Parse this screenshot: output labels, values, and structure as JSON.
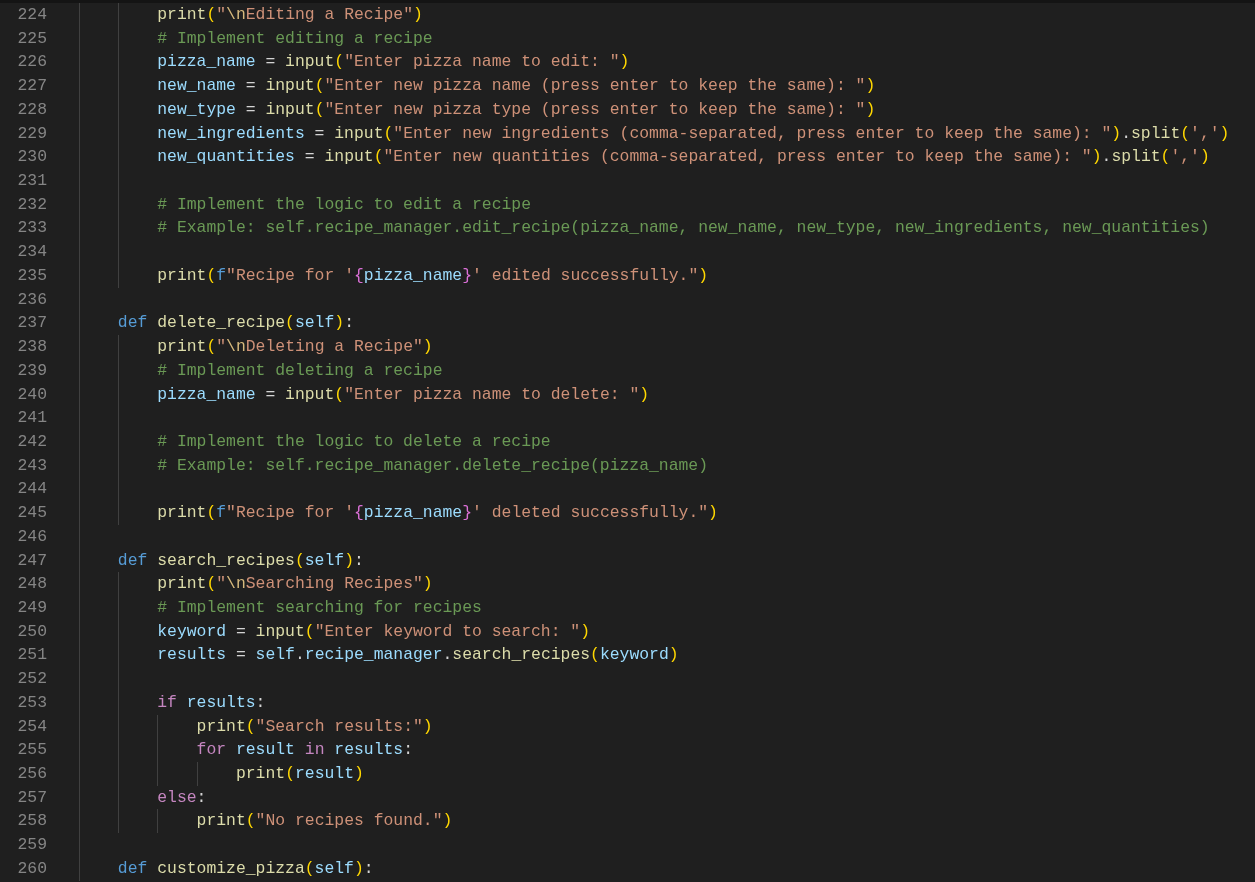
{
  "editor": {
    "lines": [
      {
        "children": [
          {
            "number": "224",
            "tokens": [
              {
                "kind": "fn",
                "text": "print"
              },
              {
                "kind": "b1",
                "text": "("
              },
              {
                "kind": "str",
                "text": "\""
              },
              {
                "kind": "esc",
                "text": "\\n"
              },
              {
                "kind": "str",
                "text": "Editing a Recipe\""
              },
              {
                "kind": "b1",
                "text": ")"
              }
            ]
          },
          {
            "number": "225",
            "tokens": [
              {
                "kind": "cmt",
                "text": "# Implement editing a recipe"
              }
            ]
          },
          {
            "number": "226",
            "tokens": [
              {
                "kind": "var",
                "text": "pizza_name"
              },
              {
                "kind": "plain",
                "text": " = "
              },
              {
                "kind": "fn",
                "text": "input"
              },
              {
                "kind": "b1",
                "text": "("
              },
              {
                "kind": "str",
                "text": "\"Enter pizza name to edit: \""
              },
              {
                "kind": "b1",
                "text": ")"
              }
            ]
          },
          {
            "number": "227",
            "tokens": [
              {
                "kind": "var",
                "text": "new_name"
              },
              {
                "kind": "plain",
                "text": " = "
              },
              {
                "kind": "fn",
                "text": "input"
              },
              {
                "kind": "b1",
                "text": "("
              },
              {
                "kind": "str",
                "text": "\"Enter new pizza name (press enter to keep the same): \""
              },
              {
                "kind": "b1",
                "text": ")"
              }
            ]
          },
          {
            "number": "228",
            "tokens": [
              {
                "kind": "var",
                "text": "new_type"
              },
              {
                "kind": "plain",
                "text": " = "
              },
              {
                "kind": "fn",
                "text": "input"
              },
              {
                "kind": "b1",
                "text": "("
              },
              {
                "kind": "str",
                "text": "\"Enter new pizza type (press enter to keep the same): \""
              },
              {
                "kind": "b1",
                "text": ")"
              }
            ]
          },
          {
            "number": "229",
            "tokens": [
              {
                "kind": "var",
                "text": "new_ingredients"
              },
              {
                "kind": "plain",
                "text": " = "
              },
              {
                "kind": "fn",
                "text": "input"
              },
              {
                "kind": "b1",
                "text": "("
              },
              {
                "kind": "str",
                "text": "\"Enter new ingredients (comma-separated, press enter to keep the same): \""
              },
              {
                "kind": "b1",
                "text": ")"
              },
              {
                "kind": "plain",
                "text": "."
              },
              {
                "kind": "fn",
                "text": "split"
              },
              {
                "kind": "b1",
                "text": "("
              },
              {
                "kind": "str",
                "text": "','"
              },
              {
                "kind": "b1",
                "text": ")"
              }
            ]
          },
          {
            "number": "230",
            "tokens": [
              {
                "kind": "var",
                "text": "new_quantities"
              },
              {
                "kind": "plain",
                "text": " = "
              },
              {
                "kind": "fn",
                "text": "input"
              },
              {
                "kind": "b1",
                "text": "("
              },
              {
                "kind": "str",
                "text": "\"Enter new quantities (comma-separated, press enter to keep the same): \""
              },
              {
                "kind": "b1",
                "text": ")"
              },
              {
                "kind": "plain",
                "text": "."
              },
              {
                "kind": "fn",
                "text": "split"
              },
              {
                "kind": "b1",
                "text": "("
              },
              {
                "kind": "str",
                "text": "','"
              },
              {
                "kind": "b1",
                "text": ")"
              }
            ]
          },
          {
            "number": "231"
          },
          {
            "number": "232",
            "tokens": [
              {
                "kind": "cmt",
                "text": "# Implement the logic to edit a recipe"
              }
            ]
          },
          {
            "number": "233",
            "tokens": [
              {
                "kind": "cmt",
                "text": "# Example: self.recipe_manager.edit_recipe(pizza_name, new_name, new_type, new_ingredients, new_quantities)"
              }
            ]
          },
          {
            "number": "234"
          },
          {
            "number": "235",
            "tokens": [
              {
                "kind": "fn",
                "text": "print"
              },
              {
                "kind": "b1",
                "text": "("
              },
              {
                "kind": "kw",
                "text": "f"
              },
              {
                "kind": "str",
                "text": "\"Recipe for '"
              },
              {
                "kind": "b2",
                "text": "{"
              },
              {
                "kind": "var",
                "text": "pizza_name"
              },
              {
                "kind": "b2",
                "text": "}"
              },
              {
                "kind": "str",
                "text": "' edited successfully.\""
              },
              {
                "kind": "b1",
                "text": ")"
              }
            ]
          }
        ]
      },
      {
        "number": "236"
      },
      {
        "number": "237",
        "tokens": [
          {
            "kind": "kw",
            "text": "def "
          },
          {
            "kind": "fn",
            "text": "delete_recipe"
          },
          {
            "kind": "b1",
            "text": "("
          },
          {
            "kind": "var",
            "text": "self"
          },
          {
            "kind": "b1",
            "text": ")"
          },
          {
            "kind": "plain",
            "text": ":"
          }
        ],
        "children": [
          {
            "number": "238",
            "tokens": [
              {
                "kind": "fn",
                "text": "print"
              },
              {
                "kind": "b1",
                "text": "("
              },
              {
                "kind": "str",
                "text": "\""
              },
              {
                "kind": "esc",
                "text": "\\n"
              },
              {
                "kind": "str",
                "text": "Deleting a Recipe\""
              },
              {
                "kind": "b1",
                "text": ")"
              }
            ]
          },
          {
            "number": "239",
            "tokens": [
              {
                "kind": "cmt",
                "text": "# Implement deleting a recipe"
              }
            ]
          },
          {
            "number": "240",
            "tokens": [
              {
                "kind": "var",
                "text": "pizza_name"
              },
              {
                "kind": "plain",
                "text": " = "
              },
              {
                "kind": "fn",
                "text": "input"
              },
              {
                "kind": "b1",
                "text": "("
              },
              {
                "kind": "str",
                "text": "\"Enter pizza name to delete: \""
              },
              {
                "kind": "b1",
                "text": ")"
              }
            ]
          },
          {
            "number": "241"
          },
          {
            "number": "242",
            "tokens": [
              {
                "kind": "cmt",
                "text": "# Implement the logic to delete a recipe"
              }
            ]
          },
          {
            "number": "243",
            "tokens": [
              {
                "kind": "cmt",
                "text": "# Example: self.recipe_manager.delete_recipe(pizza_name)"
              }
            ]
          },
          {
            "number": "244"
          },
          {
            "number": "245",
            "tokens": [
              {
                "kind": "fn",
                "text": "print"
              },
              {
                "kind": "b1",
                "text": "("
              },
              {
                "kind": "kw",
                "text": "f"
              },
              {
                "kind": "str",
                "text": "\"Recipe for '"
              },
              {
                "kind": "b2",
                "text": "{"
              },
              {
                "kind": "var",
                "text": "pizza_name"
              },
              {
                "kind": "b2",
                "text": "}"
              },
              {
                "kind": "str",
                "text": "' deleted successfully.\""
              },
              {
                "kind": "b1",
                "text": ")"
              }
            ]
          }
        ]
      },
      {
        "number": "246"
      },
      {
        "number": "247",
        "tokens": [
          {
            "kind": "kw",
            "text": "def "
          },
          {
            "kind": "fn",
            "text": "search_recipes"
          },
          {
            "kind": "b1",
            "text": "("
          },
          {
            "kind": "var",
            "text": "self"
          },
          {
            "kind": "b1",
            "text": ")"
          },
          {
            "kind": "plain",
            "text": ":"
          }
        ],
        "children": [
          {
            "number": "248",
            "tokens": [
              {
                "kind": "fn",
                "text": "print"
              },
              {
                "kind": "b1",
                "text": "("
              },
              {
                "kind": "str",
                "text": "\""
              },
              {
                "kind": "esc",
                "text": "\\n"
              },
              {
                "kind": "str",
                "text": "Searching Recipes\""
              },
              {
                "kind": "b1",
                "text": ")"
              }
            ]
          },
          {
            "number": "249",
            "tokens": [
              {
                "kind": "cmt",
                "text": "# Implement searching for recipes"
              }
            ]
          },
          {
            "number": "250",
            "tokens": [
              {
                "kind": "var",
                "text": "keyword"
              },
              {
                "kind": "plain",
                "text": " = "
              },
              {
                "kind": "fn",
                "text": "input"
              },
              {
                "kind": "b1",
                "text": "("
              },
              {
                "kind": "str",
                "text": "\"Enter keyword to search: \""
              },
              {
                "kind": "b1",
                "text": ")"
              }
            ]
          },
          {
            "number": "251",
            "tokens": [
              {
                "kind": "var",
                "text": "results"
              },
              {
                "kind": "plain",
                "text": " = "
              },
              {
                "kind": "var",
                "text": "self"
              },
              {
                "kind": "plain",
                "text": "."
              },
              {
                "kind": "var",
                "text": "recipe_manager"
              },
              {
                "kind": "plain",
                "text": "."
              },
              {
                "kind": "fn",
                "text": "search_recipes"
              },
              {
                "kind": "b1",
                "text": "("
              },
              {
                "kind": "var",
                "text": "keyword"
              },
              {
                "kind": "b1",
                "text": ")"
              }
            ]
          },
          {
            "number": "252"
          },
          {
            "number": "253",
            "tokens": [
              {
                "kind": "ctrl",
                "text": "if "
              },
              {
                "kind": "var",
                "text": "results"
              },
              {
                "kind": "plain",
                "text": ":"
              }
            ],
            "children": [
              {
                "number": "254",
                "tokens": [
                  {
                    "kind": "fn",
                    "text": "print"
                  },
                  {
                    "kind": "b1",
                    "text": "("
                  },
                  {
                    "kind": "str",
                    "text": "\"Search results:\""
                  },
                  {
                    "kind": "b1",
                    "text": ")"
                  }
                ]
              },
              {
                "number": "255",
                "tokens": [
                  {
                    "kind": "ctrl",
                    "text": "for "
                  },
                  {
                    "kind": "var",
                    "text": "result "
                  },
                  {
                    "kind": "ctrl",
                    "text": "in "
                  },
                  {
                    "kind": "var",
                    "text": "results"
                  },
                  {
                    "kind": "plain",
                    "text": ":"
                  }
                ],
                "children": [
                  {
                    "number": "256",
                    "tokens": [
                      {
                        "kind": "fn",
                        "text": "print"
                      },
                      {
                        "kind": "b1",
                        "text": "("
                      },
                      {
                        "kind": "var",
                        "text": "result"
                      },
                      {
                        "kind": "b1",
                        "text": ")"
                      }
                    ]
                  }
                ]
              }
            ]
          },
          {
            "number": "257",
            "tokens": [
              {
                "kind": "ctrl",
                "text": "else"
              },
              {
                "kind": "plain",
                "text": ":"
              }
            ],
            "children": [
              {
                "number": "258",
                "tokens": [
                  {
                    "kind": "fn",
                    "text": "print"
                  },
                  {
                    "kind": "b1",
                    "text": "("
                  },
                  {
                    "kind": "str",
                    "text": "\"No recipes found.\""
                  },
                  {
                    "kind": "b1",
                    "text": ")"
                  }
                ]
              }
            ]
          }
        ]
      },
      {
        "number": "259"
      },
      {
        "number": "260",
        "tokens": [
          {
            "kind": "kw",
            "text": "def "
          },
          {
            "kind": "fn",
            "text": "customize_pizza"
          },
          {
            "kind": "b1",
            "text": "("
          },
          {
            "kind": "var",
            "text": "self"
          },
          {
            "kind": "b1",
            "text": ")"
          },
          {
            "kind": "plain",
            "text": ":"
          }
        ]
      }
    ]
  }
}
